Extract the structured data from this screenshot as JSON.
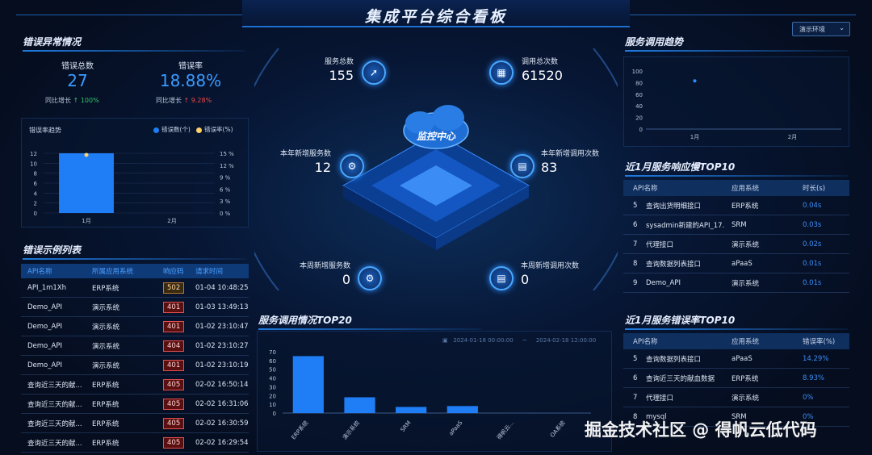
{
  "header": {
    "title": "集成平台综合看板",
    "env_select": "演示环境"
  },
  "errors": {
    "title": "错误异常情况",
    "total_label": "错误总数",
    "total_value": "27",
    "rate_label": "错误率",
    "rate_value": "18.88%",
    "yoy_label": "同比增长",
    "total_yoy": "100%",
    "rate_yoy": "9.28%",
    "trend_title": "错误率趋势",
    "legend_count": "错误数(个)",
    "legend_rate": "错误率(%)"
  },
  "error_chart": {
    "type": "bar",
    "categories": [
      "1月",
      "2月"
    ],
    "series": [
      {
        "name": "错误数(个)",
        "values": [
          12,
          0
        ]
      }
    ],
    "y_ticks": [
      "0",
      "2",
      "4",
      "6",
      "8",
      "10",
      "12"
    ],
    "y2_ticks": [
      "0 %",
      "3 %",
      "6 %",
      "9 %",
      "12 %",
      "15 %"
    ],
    "ylim": [
      0,
      12
    ]
  },
  "examples": {
    "title": "错误示例列表",
    "headers": [
      "API名称",
      "所属应用系统",
      "响应码",
      "请求时间"
    ],
    "rows": [
      [
        "API_1m1Xh",
        "ERP系统",
        "502",
        "01-04 10:48:25"
      ],
      [
        "Demo_API",
        "演示系统",
        "401",
        "01-03 13:49:13"
      ],
      [
        "Demo_API",
        "演示系统",
        "401",
        "01-02 23:10:47"
      ],
      [
        "Demo_API",
        "演示系统",
        "404",
        "01-02 23:10:27"
      ],
      [
        "Demo_API",
        "演示系统",
        "401",
        "01-02 23:10:19"
      ],
      [
        "查询近三天的献...",
        "ERP系统",
        "405",
        "02-02 16:50:14"
      ],
      [
        "查询近三天的献...",
        "ERP系统",
        "405",
        "02-02 16:31:06"
      ],
      [
        "查询近三天的献...",
        "ERP系统",
        "405",
        "02-02 16:30:59"
      ],
      [
        "查询近三天的献...",
        "ERP系统",
        "405",
        "02-02 16:29:54"
      ]
    ]
  },
  "center": {
    "label": "监控中心",
    "service_total_label": "服务总数",
    "service_total": "155",
    "call_total_label": "调用总次数",
    "call_total": "61520",
    "year_new_service_label": "本年新增服务数",
    "year_new_service": "12",
    "year_new_call_label": "本年新增调用次数",
    "year_new_call": "83",
    "week_new_service_label": "本周新增服务数",
    "week_new_service": "0",
    "week_new_call_label": "本周新增调用次数",
    "week_new_call": "0"
  },
  "top20": {
    "title": "服务调用情况TOP20",
    "date_start": "2024-01-18 00:00:00",
    "date_sep": "~",
    "date_end": "2024-02-18 12:00:00"
  },
  "top20_chart": {
    "type": "bar",
    "categories": [
      "ERP系统",
      "演示系统",
      "SRM",
      "aPaaS",
      "得帆云...",
      "OA系统"
    ],
    "values": [
      65,
      18,
      7,
      8,
      0,
      0
    ],
    "y_ticks": [
      "0",
      "10",
      "20",
      "30",
      "40",
      "50",
      "60",
      "70"
    ],
    "ylim": [
      0,
      70
    ]
  },
  "trend": {
    "title": "服务调用趋势"
  },
  "trend_chart": {
    "type": "scatter",
    "categories": [
      "1月",
      "2月"
    ],
    "values": [
      83,
      null
    ],
    "y_ticks": [
      "0",
      "20",
      "40",
      "60",
      "80",
      "100"
    ],
    "ylim": [
      0,
      100
    ]
  },
  "slow": {
    "title": "近1月服务响应慢TOP10",
    "headers": [
      "API名称",
      "应用系统",
      "时长(s)"
    ],
    "rows": [
      [
        "5",
        "查询出货明细接口",
        "ERP系统",
        "0.04s"
      ],
      [
        "6",
        "sysadmin新建的API_17...",
        "SRM",
        "0.03s"
      ],
      [
        "7",
        "代理接口",
        "演示系统",
        "0.02s"
      ],
      [
        "8",
        "查询数据列表接口",
        "aPaaS",
        "0.01s"
      ],
      [
        "9",
        "Demo_API",
        "演示系统",
        "0.01s"
      ]
    ]
  },
  "errrate": {
    "title": "近1月服务错误率TOP10",
    "headers": [
      "API名称",
      "应用系统",
      "错误率(%)"
    ],
    "rows": [
      [
        "5",
        "查询数据列表接口",
        "aPaaS",
        "14.29%"
      ],
      [
        "6",
        "查询近三天的献血数据",
        "ERP系统",
        "8.93%"
      ],
      [
        "7",
        "代理接口",
        "演示系统",
        "0%"
      ],
      [
        "8",
        "mysql",
        "SRM",
        "0%"
      ]
    ]
  },
  "watermark": "掘金技术社区 @ 得帆云低代码"
}
